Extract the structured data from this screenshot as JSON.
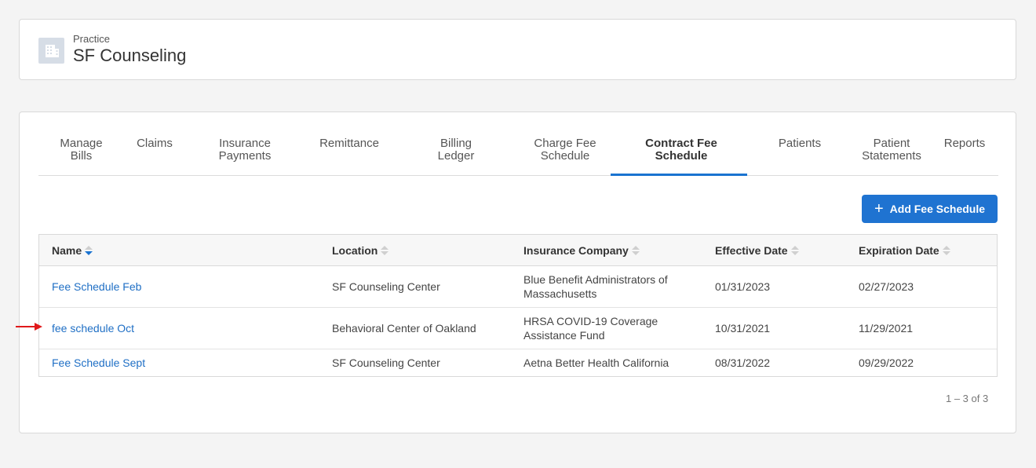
{
  "practice": {
    "label": "Practice",
    "name": "SF Counseling",
    "icon": "building-icon"
  },
  "tabs": [
    {
      "label": "Manage\nBills"
    },
    {
      "label": "Claims"
    },
    {
      "label": "Insurance\nPayments"
    },
    {
      "label": "Remittance"
    },
    {
      "label": "Billing\nLedger"
    },
    {
      "label": "Charge Fee\nSchedule"
    },
    {
      "label": "Contract Fee\nSchedule",
      "active": true
    },
    {
      "label": "Patients"
    },
    {
      "label": "Patient\nStatements"
    },
    {
      "label": "Reports"
    }
  ],
  "add_button": {
    "label": "Add Fee Schedule",
    "icon": "plus-icon"
  },
  "table": {
    "headers": [
      "Name",
      "Location",
      "Insurance Company",
      "Effective Date",
      "Expiration Date"
    ],
    "rows": [
      {
        "name": "Fee Schedule Feb",
        "location": "SF Counseling Center",
        "insurance": "Blue Benefit Administrators of Massachusetts",
        "effective": "01/31/2023",
        "expiration": "02/27/2023"
      },
      {
        "name": "fee schedule Oct",
        "location": "Behavioral Center of Oakland",
        "insurance": "HRSA COVID-19 Coverage Assistance Fund",
        "effective": "10/31/2021",
        "expiration": "11/29/2021"
      },
      {
        "name": "Fee Schedule Sept",
        "location": "SF Counseling Center",
        "insurance": "Aetna Better Health California",
        "effective": "08/31/2022",
        "expiration": "09/29/2022"
      }
    ]
  },
  "pagination": "1 – 3 of 3",
  "colors": {
    "accent": "#1f73d1",
    "link": "#1f6fc5",
    "arrow": "#e0191b"
  }
}
